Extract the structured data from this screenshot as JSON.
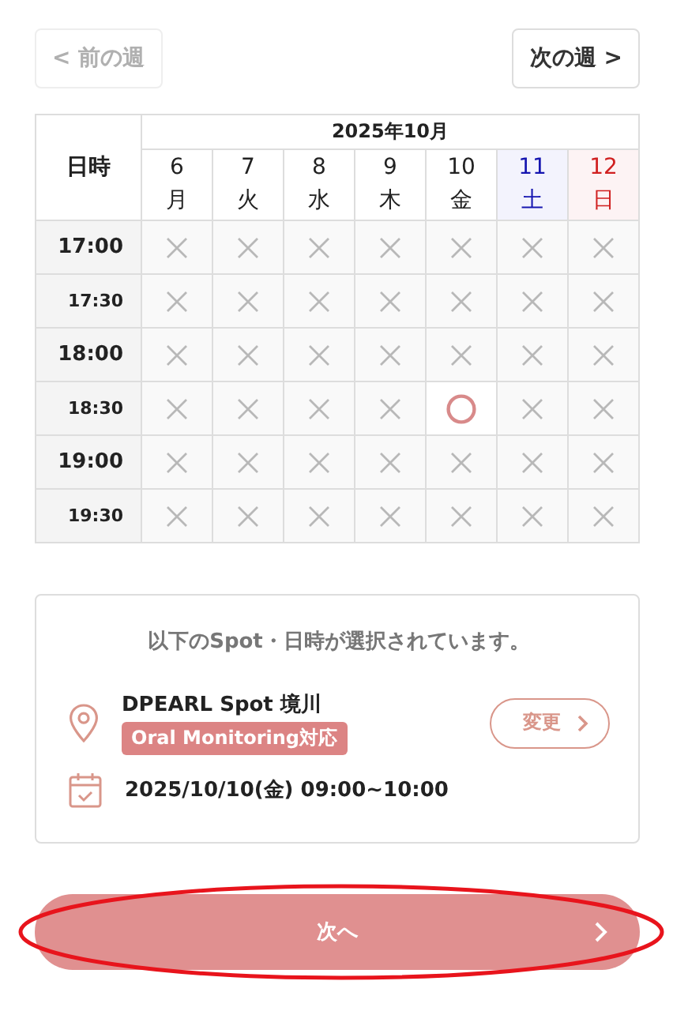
{
  "nav": [
    {
      "label": "< 前の週",
      "disabled": true
    },
    {
      "label": "次の週 >",
      "disabled": false
    }
  ],
  "table": {
    "corner": "日時",
    "month": "2025年10月",
    "days": [
      {
        "date": "6",
        "weekday": "月",
        "kind": "weekday"
      },
      {
        "date": "7",
        "weekday": "火",
        "kind": "weekday"
      },
      {
        "date": "8",
        "weekday": "水",
        "kind": "weekday"
      },
      {
        "date": "9",
        "weekday": "木",
        "kind": "weekday"
      },
      {
        "date": "10",
        "weekday": "金",
        "kind": "weekday"
      },
      {
        "date": "11",
        "weekday": "土",
        "kind": "saturday"
      },
      {
        "date": "12",
        "weekday": "日",
        "kind": "sunday"
      }
    ],
    "rows": [
      {
        "time": "17:00",
        "kind": "hour",
        "available": [
          false,
          false,
          false,
          false,
          false,
          false,
          false
        ]
      },
      {
        "time": "17:30",
        "kind": "half",
        "available": [
          false,
          false,
          false,
          false,
          false,
          false,
          false
        ]
      },
      {
        "time": "18:00",
        "kind": "hour",
        "available": [
          false,
          false,
          false,
          false,
          false,
          false,
          false
        ]
      },
      {
        "time": "18:30",
        "kind": "half",
        "available": [
          false,
          false,
          false,
          false,
          true,
          false,
          false
        ]
      },
      {
        "time": "19:00",
        "kind": "hour",
        "available": [
          false,
          false,
          false,
          false,
          false,
          false,
          false
        ]
      },
      {
        "time": "19:30",
        "kind": "half",
        "available": [
          false,
          false,
          false,
          false,
          false,
          false,
          false
        ]
      }
    ]
  },
  "summary": {
    "heading": "以下のSpot・日時が選択されています。",
    "spot": "DPEARL Spot 境川",
    "tag": "Oral Monitoring対応",
    "change": "変更",
    "datetime": "2025/10/10(金) 09:00~10:00"
  },
  "next": {
    "label": "次へ"
  },
  "annotation": {
    "kind": "ellipse"
  }
}
